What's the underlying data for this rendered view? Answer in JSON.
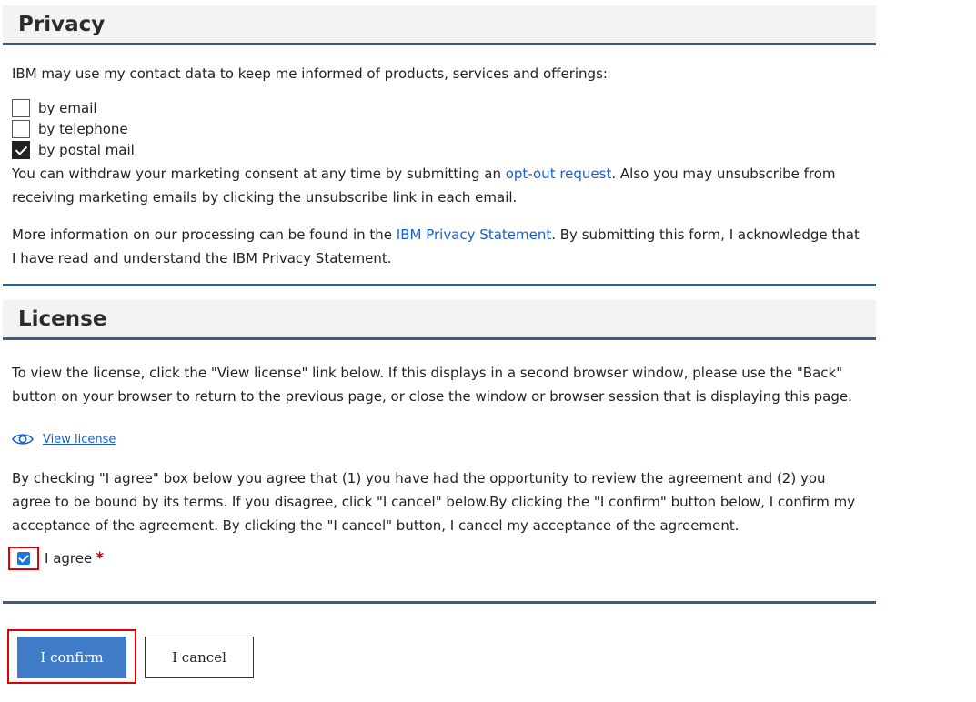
{
  "privacy": {
    "title": "Privacy",
    "intro": "IBM may use my contact data to keep me informed of products, services and offerings:",
    "options": [
      {
        "label": "by email",
        "checked": false
      },
      {
        "label": "by telephone",
        "checked": false
      },
      {
        "label": "by postal mail",
        "checked": true
      }
    ],
    "withdraw_text_before": "You can withdraw your marketing consent at any time by submitting an ",
    "withdraw_link": "opt-out request",
    "withdraw_text_after": ". Also you may unsubscribe from receiving marketing emails by clicking the unsubscribe link in each email.",
    "more_info_before": "More information on our processing can be found in the ",
    "more_info_link": "IBM Privacy Statement",
    "more_info_after": ". By submitting this form, I acknowledge that I have read and understand the IBM Privacy Statement."
  },
  "license": {
    "title": "License",
    "instructions": "To view the license, click the \"View license\" link below. If this displays in a second browser window, please use the \"Back\" button on your browser to return to the previous page, or close the window or browser session that is displaying this page.",
    "view_license_label": "View license",
    "view_license_icon": "eye-icon",
    "agreement_text": "By checking \"I agree\" box below you agree that (1) you have had the opportunity to review the agreement and (2) you agree to be bound by its terms. If you disagree, click \"I cancel\" below.By clicking the \"I confirm\" button below, I confirm my acceptance of the agreement. By clicking the \"I cancel\" button, I cancel my acceptance of the agreement.",
    "agree_label": "I agree",
    "agree_checked": true,
    "required_marker": "*"
  },
  "actions": {
    "confirm_label": "I confirm",
    "cancel_label": "I cancel"
  },
  "colors": {
    "accent": "#3d5a80",
    "link": "#1a5fd0",
    "confirm_button": "#3f7bc6",
    "highlight": "#e00000"
  }
}
